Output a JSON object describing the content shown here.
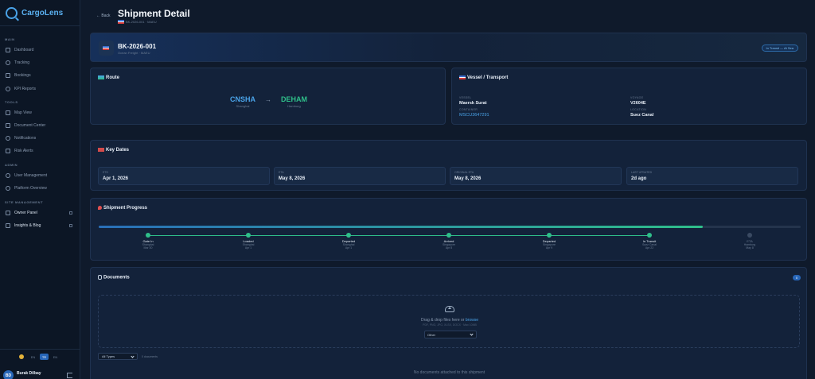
{
  "sidebar": {
    "brand": "CargoLens",
    "sections": {
      "main": "MAIN",
      "tools": "TOOLS",
      "admin": "ADMIN",
      "site_management": "SITE MANAGEMENT"
    },
    "items": {
      "dashboard": "Dashboard",
      "tracking": "Tracking",
      "bookings": "Bookings",
      "kpi_reports": "KPI Reports",
      "map_view": "Map View",
      "document_center": "Document Center",
      "notifications": "Notifications",
      "risk_alerts": "Risk Alerts",
      "user_management": "User Management",
      "platform_overview": "Platform Overview",
      "owner_panel": "Owner Panel",
      "insights_blog": "Insights & Blog"
    },
    "languages": [
      "EN",
      "TR",
      "EN"
    ],
    "user": {
      "initials": "BD",
      "name": "Burak Dilbay"
    }
  },
  "header": {
    "back_label": "← Back",
    "title": "Shipment Detail",
    "subtitle": "BK-2026-001 · MAEU"
  },
  "shipment": {
    "id": "BK-2026-001",
    "sub": "Ocean Freight · MAEU",
    "status": "In Transit — At Sea"
  },
  "route": {
    "title": "Route",
    "origin_code": "CNSHA",
    "origin_city": "Shanghai",
    "arrow": "→",
    "dest_code": "DEHAM",
    "dest_city": "Hamburg"
  },
  "vessel": {
    "title": "Vessel / Transport",
    "vessel_label": "VESSEL",
    "vessel_value": "Maersk Surat",
    "voyage_label": "VOYAGE",
    "voyage_value": "V2604E",
    "container_label": "CONTAINER",
    "container_value": "MSCU3647291",
    "location_label": "LOCATION",
    "location_value": "Suez Canal"
  },
  "dates": {
    "title": "Key Dates",
    "items": [
      {
        "label": "ETD",
        "value": "Apr 1, 2026"
      },
      {
        "label": "ETA",
        "value": "May 8, 2026"
      },
      {
        "label": "ORIGINAL ETA",
        "value": "May 8, 2026"
      },
      {
        "label": "LAST UPDATED",
        "value": "2d ago"
      }
    ]
  },
  "progress": {
    "title": "Shipment Progress",
    "percent": 86,
    "stages": [
      {
        "label": "Gate In",
        "location": "Shanghai",
        "date": "Mar 30",
        "done": true
      },
      {
        "label": "Loaded",
        "location": "Shanghai",
        "date": "Apr 1",
        "done": true
      },
      {
        "label": "Departed",
        "location": "Shanghai",
        "date": "Apr 1",
        "done": true
      },
      {
        "label": "Arrived",
        "location": "Singapore",
        "date": "Apr 8",
        "done": true
      },
      {
        "label": "Departed",
        "location": "Singapore",
        "date": "Apr 9",
        "done": true
      },
      {
        "label": "In Transit",
        "location": "Suez Canal",
        "date": "Apr 22",
        "done": true
      },
      {
        "label": "ETA",
        "location": "Hamburg",
        "date": "May 8",
        "done": false
      }
    ]
  },
  "documents": {
    "title": "Documents",
    "count": "0",
    "drop_text": "Drag & drop files here or",
    "browse": "browse",
    "hint": "PDF, PNG, JPG, XLSX, DOCX · Max 10MB",
    "type_selected": "Other",
    "filter_selected": "All Types",
    "filter_count": "0 documents",
    "empty": "No documents attached to this shipment"
  },
  "colors": {
    "accent": "#4aa3e8",
    "success": "#2fbf8a",
    "background": "#0f1a2b"
  }
}
